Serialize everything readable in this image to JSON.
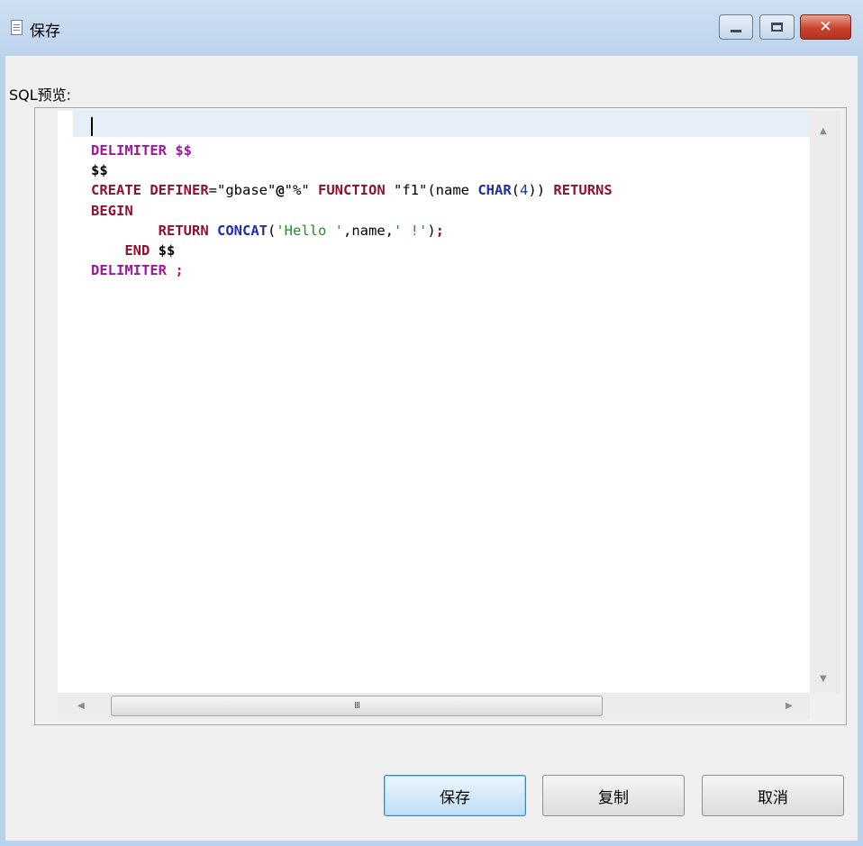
{
  "window": {
    "title": "保存",
    "controls": {
      "minimize": "minimize",
      "maximize": "maximize",
      "close": "✕"
    }
  },
  "preview": {
    "label": "SQL预览:"
  },
  "code_lines": [
    "DELIMITER $$",
    "$$",
    "CREATE DEFINER=\"gbase\"@\"%\" FUNCTION \"f1\"(name CHAR(4)) RETURNS",
    "BEGIN",
    "        RETURN CONCAT('Hello ',name,' !');",
    "    END $$",
    "DELIMITER ;"
  ],
  "scrollbar": {
    "grip": "III"
  },
  "buttons": {
    "save": "保存",
    "copy": "复制",
    "cancel": "取消"
  }
}
